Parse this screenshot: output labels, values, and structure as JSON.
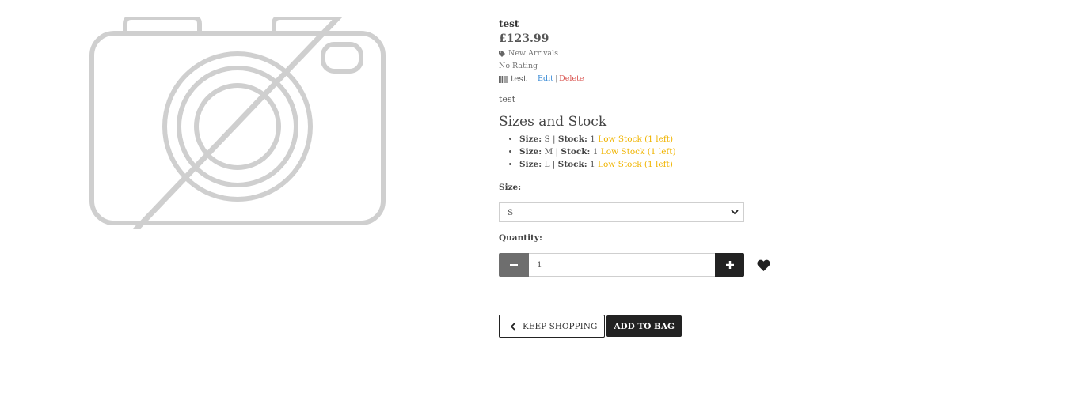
{
  "product": {
    "image_icon": "no-image-camera-icon",
    "name": "test",
    "price": "£123.99",
    "category": "New Arrivals",
    "rating": "No Rating",
    "sku": "test",
    "edit_label": "Edit",
    "separator": "|",
    "delete_label": "Delete",
    "description": "test"
  },
  "sizes": {
    "heading": "Sizes and Stock",
    "size_label": "Size:",
    "stock_label": "Stock:",
    "items": [
      {
        "size": "S",
        "stock": "1",
        "status": "Low Stock (1 left)"
      },
      {
        "size": "M",
        "stock": "1",
        "status": "Low Stock (1 left)"
      },
      {
        "size": "L",
        "stock": "1",
        "status": "Low Stock (1 left)"
      }
    ]
  },
  "form": {
    "size_label": "Size:",
    "size_selected": "S",
    "quantity_label": "Quantity:",
    "quantity_value": "1"
  },
  "buttons": {
    "keep_shopping": "KEEP SHOPPING",
    "add_to_bag": "ADD TO BAG"
  },
  "colors": {
    "low_stock": "#f0b400",
    "edit_link": "#3a8bd6",
    "delete_link": "#d9534f",
    "dark_button": "#222222",
    "minus_button": "#6e6e6e"
  }
}
